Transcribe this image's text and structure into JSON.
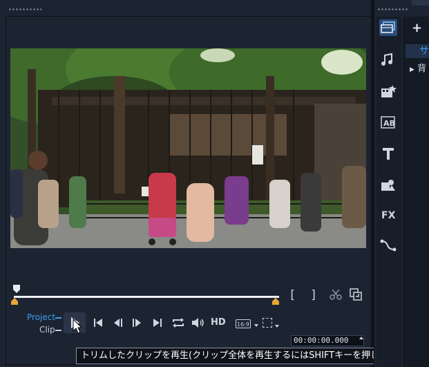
{
  "preview": {
    "project_label": "Project",
    "clip_label": "Clip",
    "hd_label": "HD",
    "aspect_label": "16:9",
    "mark_in": "[",
    "mark_out": "]",
    "timecode": "00:00:00.000"
  },
  "tooltip": {
    "text": "トリムしたクリップを再生(クリップ全体を再生するにはSHIFTキーを押します)"
  },
  "library": {
    "add_label": "+",
    "rail_icons": [
      "media-icon",
      "music-icon",
      "instant-project-icon",
      "title-ab-icon",
      "text-icon",
      "graphics-icon",
      "fx-icon",
      "path-icon"
    ],
    "fx_label": "FX",
    "items": [
      {
        "label": "サ"
      },
      {
        "label": "背"
      }
    ],
    "expand_glyph": "▶"
  },
  "colors": {
    "accent": "#3d9cf0",
    "panel": "#1c2432",
    "selected_rail": "#2a4d7a"
  }
}
